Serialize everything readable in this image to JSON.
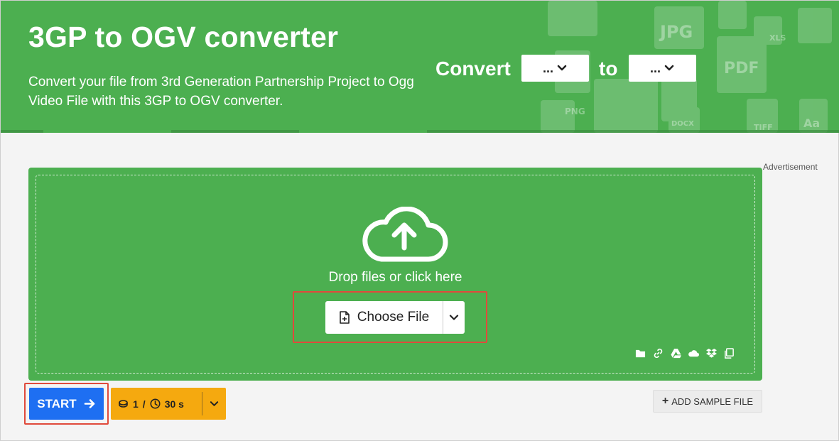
{
  "header": {
    "title": "3GP to OGV converter",
    "subtitle": "Convert your file from 3rd Generation Partnership Project to Ogg Video File with this 3GP to OGV converter.",
    "convert_label": "Convert",
    "to_label": "to",
    "from_format": "...",
    "to_format": "...",
    "bg_icon_labels": [
      "JPG",
      "PDF",
      "PNG",
      "DOCX",
      "XLS",
      "TIFF",
      "Aa"
    ]
  },
  "ad": {
    "label": "Advertisement"
  },
  "dropzone": {
    "text": "Drop files or click here",
    "choose_label": "Choose File",
    "sources": [
      "folder-icon",
      "link-icon",
      "google-drive-icon",
      "onedrive-icon",
      "dropbox-icon",
      "clipboard-icon"
    ]
  },
  "actions": {
    "start_label": "START",
    "limit_files": "1",
    "limit_sep": "/",
    "limit_time": "30 s",
    "sample_label": "ADD SAMPLE FILE",
    "sample_plus": "+"
  },
  "colors": {
    "green": "#4caf50",
    "blue": "#1e6ff2",
    "orange": "#f5a90f",
    "highlight": "#e04a3c"
  }
}
